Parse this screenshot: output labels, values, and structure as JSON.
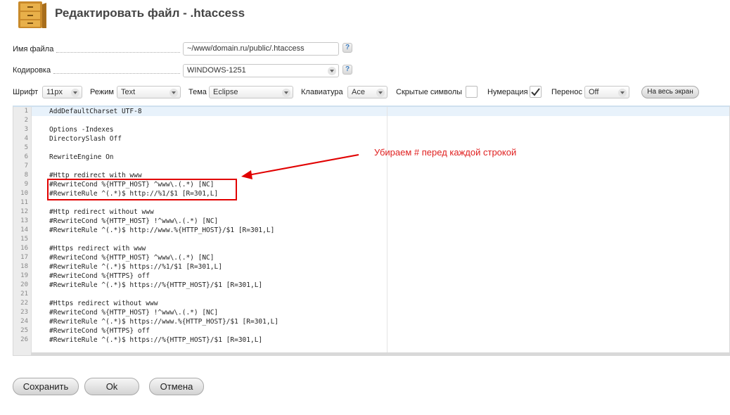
{
  "header": {
    "title": "Редактировать файл - .htaccess",
    "icon": "file-cabinet-icon"
  },
  "form": {
    "filename": {
      "label": "Имя файла",
      "value": "~/www/domain.ru/public/.htaccess",
      "help": "?"
    },
    "encoding": {
      "label": "Кодировка",
      "value": "WINDOWS-1251",
      "help": "?"
    }
  },
  "toolbar": {
    "font": {
      "label": "Шрифт",
      "value": "11px"
    },
    "mode": {
      "label": "Режим",
      "value": "Text"
    },
    "theme": {
      "label": "Тема",
      "value": "Eclipse"
    },
    "keyboard": {
      "label": "Клавиатура",
      "value": "Ace"
    },
    "hidden_symbols": {
      "label": "Скрытые символы",
      "checked": false
    },
    "numbering": {
      "label": "Нумерация",
      "checked": true
    },
    "wrap": {
      "label": "Перенос",
      "value": "Off"
    },
    "fullscreen_label": "На весь экран"
  },
  "editor": {
    "lines": [
      "AddDefaultCharset UTF-8",
      "",
      "Options -Indexes",
      "DirectorySlash Off",
      "",
      "RewriteEngine On",
      "",
      "#Http redirect with www",
      "#RewriteCond %{HTTP_HOST} ^www\\.(.*) [NC]",
      "#RewriteRule ^(.*)$ http://%1/$1 [R=301,L]",
      "",
      "#Http redirect without www",
      "#RewriteCond %{HTTP_HOST} !^www\\.(.*) [NC]",
      "#RewriteRule ^(.*)$ http://www.%{HTTP_HOST}/$1 [R=301,L]",
      "",
      "#Https redirect with www",
      "#RewriteCond %{HTTP_HOST} ^www\\.(.*) [NC]",
      "#RewriteRule ^(.*)$ https://%1/$1 [R=301,L]",
      "#RewriteCond %{HTTPS} off",
      "#RewriteRule ^(.*)$ https://%{HTTP_HOST}/$1 [R=301,L]",
      "",
      "#Https redirect without www",
      "#RewriteCond %{HTTP_HOST} !^www\\.(.*) [NC]",
      "#RewriteRule ^(.*)$ https://www.%{HTTP_HOST}/$1 [R=301,L]",
      "#RewriteCond %{HTTPS} off",
      "#RewriteRule ^(.*)$ https://%{HTTP_HOST}/$1 [R=301,L]"
    ],
    "line_numbers": [
      "1",
      "2",
      "3",
      "4",
      "5",
      "6",
      "7",
      "8",
      "9",
      "10",
      "11",
      "12",
      "13",
      "14",
      "15",
      "16",
      "17",
      "18",
      "19",
      "20",
      "21",
      "22",
      "23",
      "24",
      "25",
      "26"
    ]
  },
  "annotation": {
    "text": "Убираем # перед каждой строкой",
    "color": "#e02020"
  },
  "footer": {
    "save_label": "Сохранить",
    "ok_label": "Ok",
    "cancel_label": "Отмена"
  },
  "colors": {
    "accent_red": "#e10000",
    "gutter": "#ececec"
  }
}
